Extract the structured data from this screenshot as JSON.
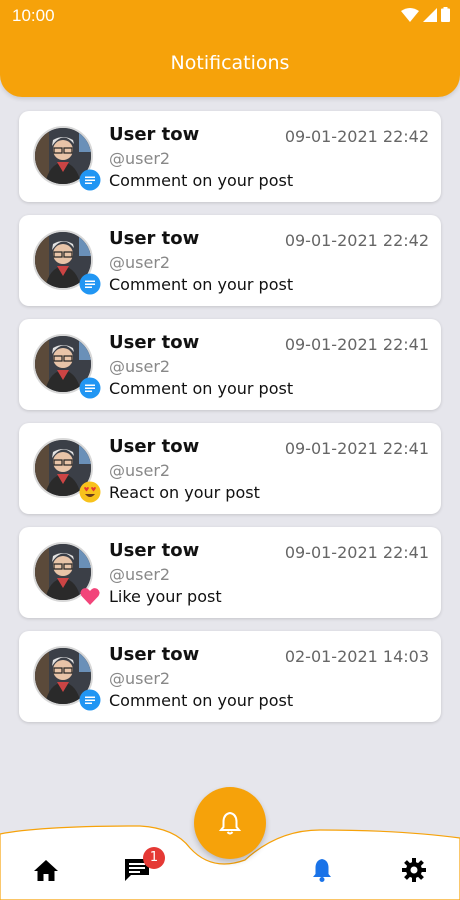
{
  "status_bar": {
    "time": "10:00"
  },
  "header": {
    "title": "Notifications"
  },
  "notifications": [
    {
      "name": "User tow",
      "handle": "@user2",
      "message": "Comment on your post",
      "time": "09-01-2021 22:42",
      "badge": "comment-icon"
    },
    {
      "name": "User tow",
      "handle": "@user2",
      "message": "Comment on your post",
      "time": "09-01-2021 22:42",
      "badge": "comment-icon"
    },
    {
      "name": "User tow",
      "handle": "@user2",
      "message": "Comment on your post",
      "time": "09-01-2021 22:41",
      "badge": "comment-icon"
    },
    {
      "name": "User tow",
      "handle": "@user2",
      "message": "React on your post",
      "time": "09-01-2021 22:41",
      "badge": "heart-eyes-emoji-icon"
    },
    {
      "name": "User tow",
      "handle": "@user2",
      "message": "Like your post",
      "time": "09-01-2021 22:41",
      "badge": "heart-icon"
    },
    {
      "name": "User tow",
      "handle": "@user2",
      "message": "Comment on your post",
      "time": "02-01-2021 14:03",
      "badge": "comment-icon"
    }
  ],
  "bottom_nav": {
    "items": [
      "home-icon",
      "chat-icon",
      "bell-icon",
      "settings-icon"
    ],
    "chat_badge_count": "1",
    "active": "bell-icon"
  },
  "colors": {
    "accent": "#f6a20a",
    "active_nav": "#1a73e8",
    "badge": "#e53935",
    "comment_badge": "#2196f3"
  }
}
